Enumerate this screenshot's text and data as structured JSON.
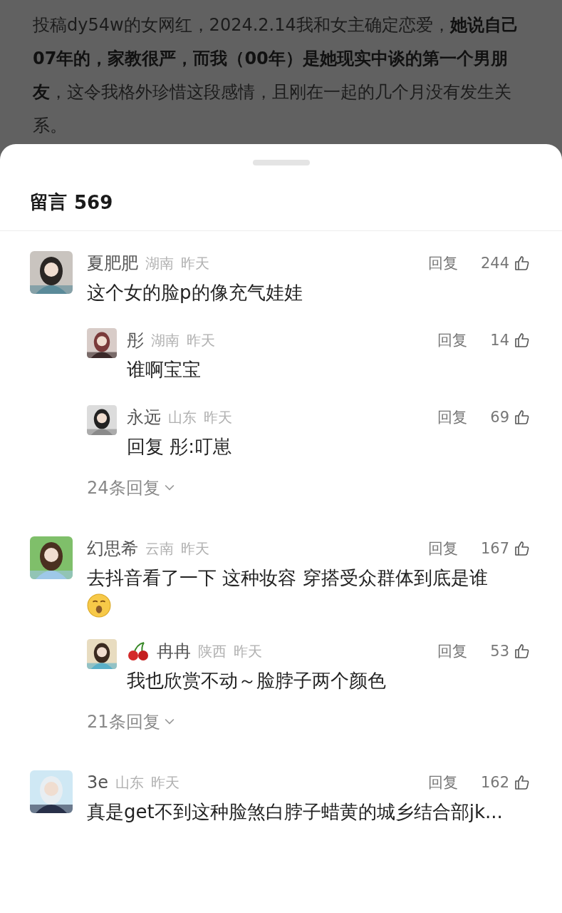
{
  "article": {
    "text": "投稿dy54w的女网红，2024.2.14我和女主确定恋爱，**她说自己07年的，家教很严，而我（00年）是她现实中谈的第一个男朋友**，这令我格外珍惜这段感情，且刚在一起的几个月没有发生关系。"
  },
  "comments_header": {
    "title": "留言",
    "count": "569"
  },
  "comments": [
    {
      "name": "夏肥肥",
      "location": "湖南",
      "time": "昨天",
      "reply_label": "回复",
      "likes": "244",
      "text": "这个女的脸p的像充气娃娃",
      "has_emoji": false,
      "replies": [
        {
          "name": "彤",
          "location": "湖南",
          "time": "昨天",
          "reply_label": "回复",
          "likes": "14",
          "text": "谁啊宝宝",
          "has_badge": false
        },
        {
          "name": "永远",
          "location": "山东",
          "time": "昨天",
          "reply_label": "回复",
          "likes": "69",
          "text": "回复 彤:叮崽",
          "has_badge": false
        }
      ],
      "more_replies": "24条回复"
    },
    {
      "name": "幻思希",
      "location": "云南",
      "time": "昨天",
      "reply_label": "回复",
      "likes": "167",
      "text": "去抖音看了一下 这种妆容 穿搭受众群体到底是谁",
      "has_emoji": true,
      "replies": [
        {
          "name": "冉冉",
          "location": "陕西",
          "time": "昨天",
          "reply_label": "回复",
          "likes": "53",
          "text": "我也欣赏不动～脸脖子两个颜色",
          "has_badge": true
        }
      ],
      "more_replies": "21条回复"
    },
    {
      "name": "3e",
      "location": "山东",
      "time": "昨天",
      "reply_label": "回复",
      "likes": "162",
      "text": "真是get不到这种脸煞白脖子蜡黄的城乡结合部jk...",
      "has_emoji": false
    }
  ]
}
